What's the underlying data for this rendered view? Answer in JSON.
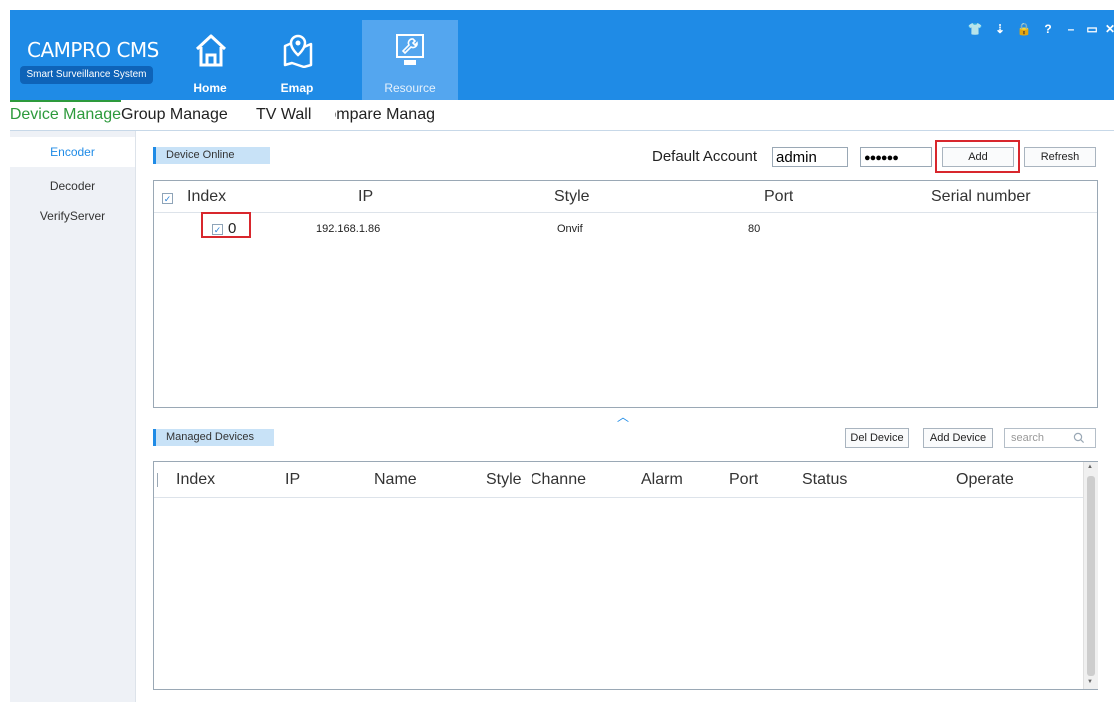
{
  "app": {
    "title": "CAMPRO CMS",
    "subtitle": "Smart Surveillance System",
    "nav": [
      {
        "label": "Home",
        "icon": "home-icon"
      },
      {
        "label": "Emap",
        "icon": "map-pin-icon"
      },
      {
        "label": "Resource",
        "icon": "wrench-monitor-icon"
      }
    ],
    "window_controls": [
      {
        "glyph": "👕",
        "name": "skin-icon"
      },
      {
        "glyph": "⇣",
        "name": "user-icon"
      },
      {
        "glyph": "🔒",
        "name": "lock-icon"
      },
      {
        "glyph": "?",
        "name": "help-icon"
      },
      {
        "glyph": "–",
        "name": "minimize-icon"
      },
      {
        "glyph": "▭",
        "name": "maximize-icon"
      },
      {
        "glyph": "✕",
        "name": "close-icon"
      }
    ],
    "accent": "#1f8be6",
    "highlight": "#d8272d",
    "active_tab_color": "#2d9a3c"
  },
  "tabs": [
    {
      "label": "Device Manage"
    },
    {
      "label": "Group Manage"
    },
    {
      "label": "TV Wall"
    },
    {
      "label": "Compare Manag"
    }
  ],
  "sidebar": {
    "items": [
      {
        "label": "Encoder"
      },
      {
        "label": "Decoder"
      },
      {
        "label": "VerifyServer"
      }
    ]
  },
  "online": {
    "section": "Device Online",
    "default_account_label": "Default Account",
    "username": "admin",
    "password": "●●●●●●",
    "add_label": "Add",
    "refresh_label": "Refresh",
    "columns": [
      "Index",
      "IP",
      "Style",
      "Port",
      "Serial number"
    ],
    "rows": [
      {
        "index": "0",
        "ip": "192.168.1.86",
        "style": "Onvif",
        "port": "80",
        "serial": ""
      }
    ],
    "collapse_glyph": "︿"
  },
  "managed": {
    "section": "Managed Devices",
    "del_label": "Del Device",
    "add_label": "Add Device",
    "search_placeholder": "search",
    "columns": [
      "Index",
      "IP",
      "Name",
      "Style",
      "Channe",
      "Alarm",
      "Port",
      "Status",
      "Operate"
    ]
  }
}
